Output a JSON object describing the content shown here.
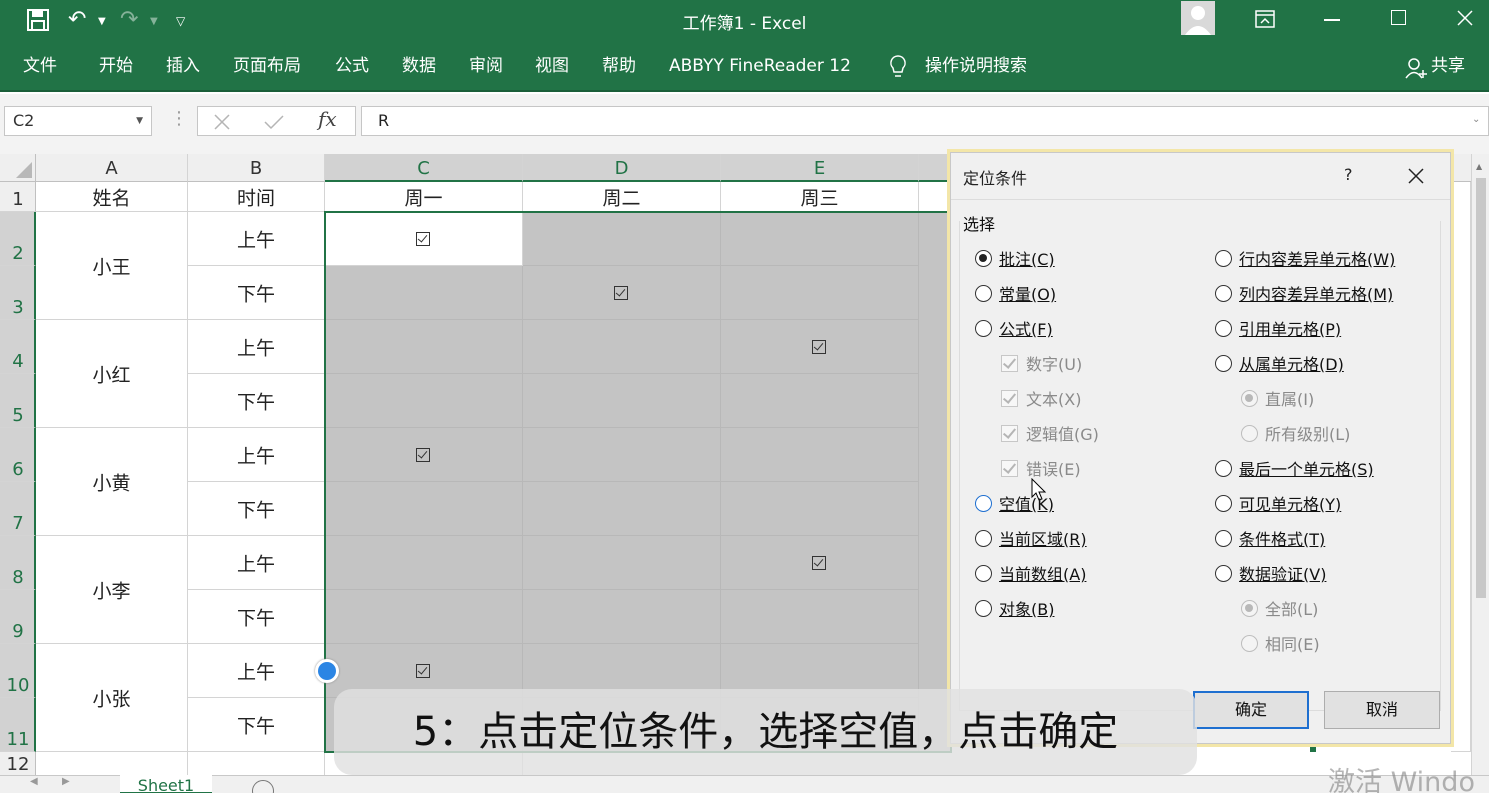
{
  "title": "工作簿1  -  Excel",
  "ribbon_tabs": [
    "文件",
    "开始",
    "插入",
    "页面布局",
    "公式",
    "数据",
    "审阅",
    "视图",
    "帮助",
    "ABBYY FineReader 12"
  ],
  "tell_me": "操作说明搜索",
  "share": "共享",
  "name_box": "C2",
  "formula_value": "R",
  "columns": [
    "A",
    "B",
    "C",
    "D",
    "E"
  ],
  "rows": [
    "1",
    "2",
    "3",
    "4",
    "5",
    "6",
    "7",
    "8",
    "9",
    "10",
    "11",
    "12"
  ],
  "headers": {
    "name": "姓名",
    "time": "时间",
    "mon": "周一",
    "tue": "周二",
    "wed": "周三"
  },
  "names": [
    "小王",
    "小红",
    "小黄",
    "小李",
    "小张"
  ],
  "am": "上午",
  "pm": "下午",
  "sheet_tab": "Sheet1",
  "dialog": {
    "title": "定位条件",
    "help": "?",
    "group": "选择",
    "left_options": [
      {
        "label": "批注",
        "key": "(C)",
        "state": "on"
      },
      {
        "label": "常量",
        "key": "(O)",
        "state": "off"
      },
      {
        "label": "公式",
        "key": "(F)",
        "state": "off"
      },
      {
        "label": "数字",
        "key": "(U)",
        "state": "cbx"
      },
      {
        "label": "文本",
        "key": "(X)",
        "state": "cbx"
      },
      {
        "label": "逻辑值",
        "key": "(G)",
        "state": "cbx"
      },
      {
        "label": "错误",
        "key": "(E)",
        "state": "cbx"
      },
      {
        "label": "空值",
        "key": "(K)",
        "state": "hover"
      },
      {
        "label": "当前区域",
        "key": "(R)",
        "state": "off"
      },
      {
        "label": "当前数组",
        "key": "(A)",
        "state": "off"
      },
      {
        "label": "对象",
        "key": "(B)",
        "state": "off"
      }
    ],
    "right_options": [
      {
        "label": "行内容差异单元格",
        "key": "(W)",
        "state": "off"
      },
      {
        "label": "列内容差异单元格",
        "key": "(M)",
        "state": "off"
      },
      {
        "label": "引用单元格",
        "key": "(P)",
        "state": "off"
      },
      {
        "label": "从属单元格",
        "key": "(D)",
        "state": "off"
      },
      {
        "label": "直属",
        "key": "(I)",
        "state": "dis-on"
      },
      {
        "label": "所有级别",
        "key": "(L)",
        "state": "dis"
      },
      {
        "label": "最后一个单元格",
        "key": "(S)",
        "state": "off"
      },
      {
        "label": "可见单元格",
        "key": "(Y)",
        "state": "off"
      },
      {
        "label": "条件格式",
        "key": "(T)",
        "state": "off"
      },
      {
        "label": "数据验证",
        "key": "(V)",
        "state": "off"
      },
      {
        "label": "全部",
        "key": "(L)",
        "state": "dis-on"
      },
      {
        "label": "相同",
        "key": "(E)",
        "state": "dis"
      }
    ],
    "ok": "确定",
    "cancel": "取消"
  },
  "caption": "5：点击定位条件，选择空值，点击确定",
  "watermark": "激活 Windo"
}
